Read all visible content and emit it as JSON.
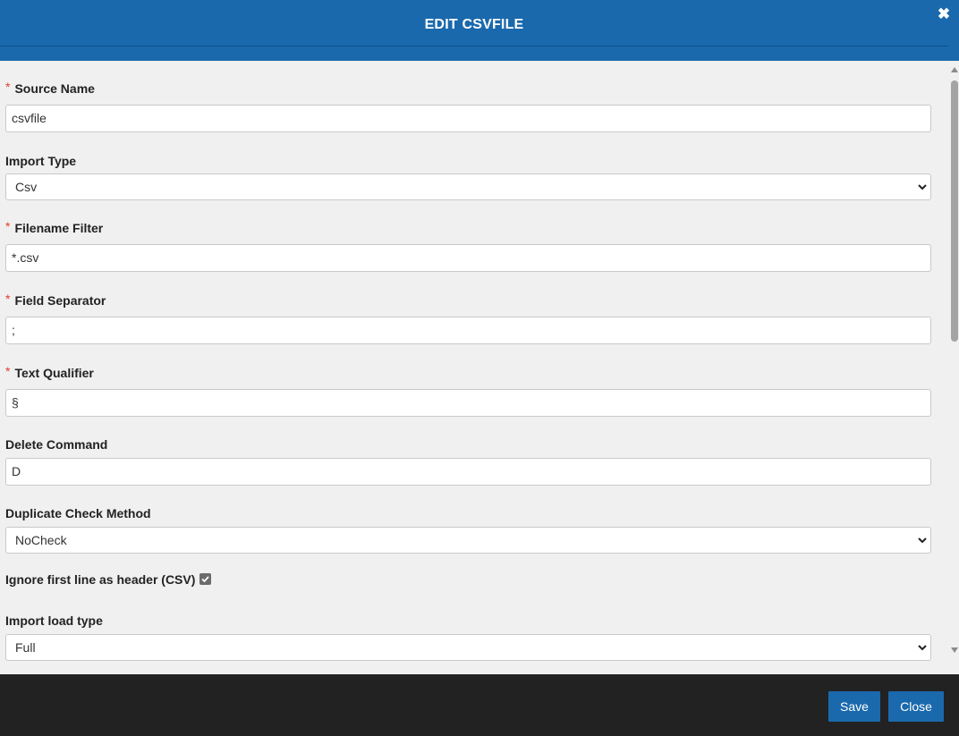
{
  "dialog": {
    "title": "EDIT CSVFILE",
    "close_glyph": "✖"
  },
  "fields": {
    "source_name": {
      "label": "Source Name",
      "required": "*",
      "value": "csvfile"
    },
    "import_type": {
      "label": "Import Type",
      "value": "Csv"
    },
    "filename_filter": {
      "label": "Filename Filter",
      "required": "*",
      "value": "*.csv"
    },
    "field_separator": {
      "label": "Field Separator",
      "required": "*",
      "value": ";"
    },
    "text_qualifier": {
      "label": "Text Qualifier",
      "required": "*",
      "value": "§"
    },
    "delete_command": {
      "label": "Delete Command",
      "value": "D"
    },
    "duplicate_check": {
      "label": "Duplicate Check Method",
      "value": "NoCheck"
    },
    "ignore_header": {
      "label": "Ignore first line as header (CSV)",
      "checked": true
    },
    "import_load_type": {
      "label": "Import load type",
      "value": "Full"
    }
  },
  "footer": {
    "save_label": "Save",
    "close_label": "Close"
  },
  "colors": {
    "header": "#1a69ad",
    "footer": "#222222",
    "required": "#e0402a"
  }
}
